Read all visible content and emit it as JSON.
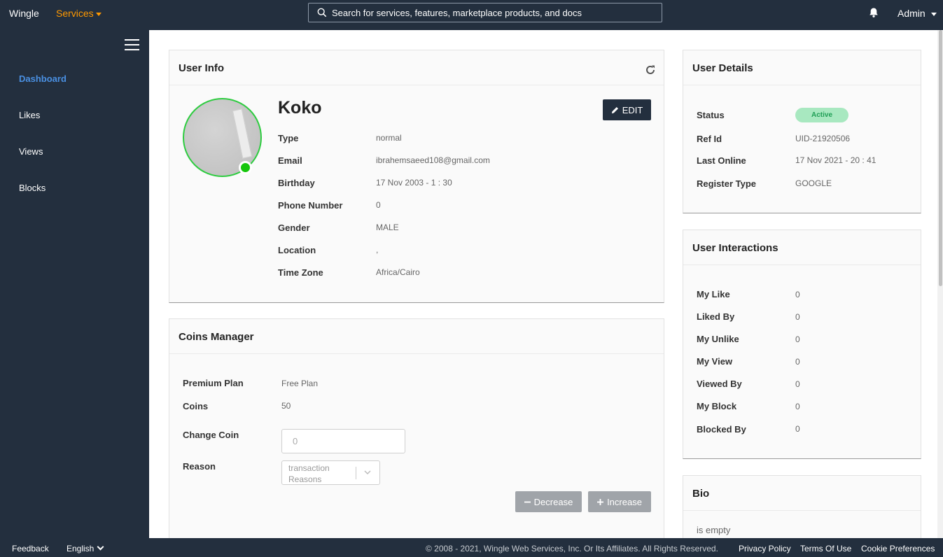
{
  "topnav": {
    "brand": "Wingle",
    "services_label": "Services",
    "search_placeholder": "Search for services, features, marketplace products, and docs",
    "user_label": "Admin"
  },
  "sidebar": {
    "items": [
      {
        "label": "Dashboard",
        "active": true
      },
      {
        "label": "Likes",
        "active": false
      },
      {
        "label": "Views",
        "active": false
      },
      {
        "label": "Blocks",
        "active": false
      }
    ]
  },
  "user_info": {
    "title": "User Info",
    "name": "Koko",
    "edit_label": "EDIT",
    "fields": [
      {
        "label": "Type",
        "value": "normal"
      },
      {
        "label": "Email",
        "value": "ibrahemsaeed108@gmail.com"
      },
      {
        "label": "Birthday",
        "value": "17 Nov 2003 - 1 : 30"
      },
      {
        "label": "Phone Number",
        "value": "0"
      },
      {
        "label": "Gender",
        "value": "MALE"
      },
      {
        "label": "Location",
        "value": ","
      },
      {
        "label": "Time Zone",
        "value": "Africa/Cairo"
      }
    ]
  },
  "coins_manager": {
    "title": "Coins Manager",
    "premium_plan_label": "Premium Plan",
    "premium_plan_value": "Free Plan",
    "coins_label": "Coins",
    "coins_value": "50",
    "change_coin_label": "Change Coin",
    "change_coin_placeholder": "0",
    "reason_label": "Reason",
    "reason_placeholder": "transaction Reasons",
    "decrease_label": "Decrease",
    "increase_label": "Increase"
  },
  "user_details": {
    "title": "User Details",
    "status_label": "Status",
    "status_value": "Active",
    "status_color": "#a8e8c0",
    "fields": [
      {
        "label": "Ref Id",
        "value": "UID-21920506"
      },
      {
        "label": "Last Online",
        "value": "17 Nov 2021 - 20 : 41"
      },
      {
        "label": "Register Type",
        "value": "GOOGLE"
      }
    ]
  },
  "user_interactions": {
    "title": "User Interactions",
    "fields": [
      {
        "label": "My Like",
        "value": "0"
      },
      {
        "label": "Liked By",
        "value": "0"
      },
      {
        "label": "My Unlike",
        "value": "0"
      },
      {
        "label": "My View",
        "value": "0"
      },
      {
        "label": "Viewed By",
        "value": "0"
      },
      {
        "label": "My Block",
        "value": "0"
      },
      {
        "label": "Blocked By",
        "value": "0"
      }
    ]
  },
  "bio": {
    "title": "Bio",
    "text": "is empty"
  },
  "footer": {
    "feedback": "Feedback",
    "language": "English",
    "copyright": "© 2008 - 2021, Wingle Web Services, Inc. Or Its Affiliates. All Rights Reserved.",
    "privacy": "Privacy Policy",
    "terms": "Terms Of Use",
    "cookies": "Cookie Preferences"
  },
  "colors": {
    "nav_bg": "#232f3e",
    "accent_orange": "#ff9900",
    "active_blue": "#4a90e2",
    "online_green": "#16c60c"
  },
  "icons": [
    "search-icon",
    "bell-icon",
    "hamburger-icon",
    "refresh-icon",
    "pencil-icon",
    "chevron-down-icon",
    "minus-icon",
    "plus-icon"
  ]
}
